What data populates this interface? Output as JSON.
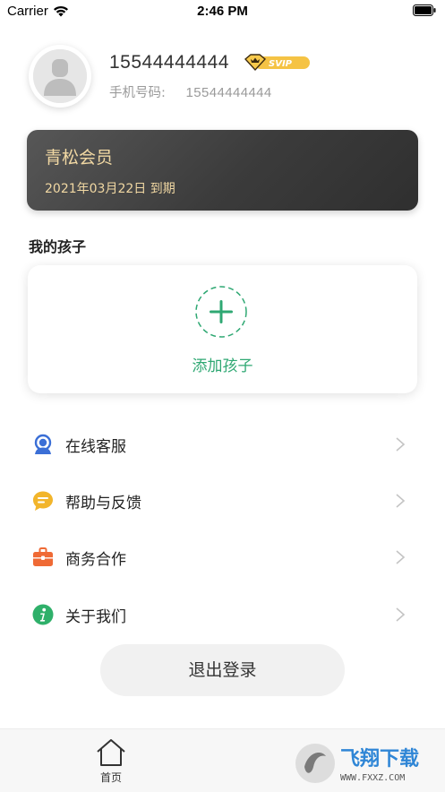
{
  "status_bar": {
    "carrier": "Carrier",
    "time": "2:46 PM"
  },
  "profile": {
    "username": "15544444444",
    "badge": "SVIP",
    "phone_label": "手机号码:",
    "phone_value": "15544444444"
  },
  "membership": {
    "title": "青松会员",
    "expire": "2021年03月22日 到期"
  },
  "kids": {
    "heading": "我的孩子",
    "add_label": "添加孩子"
  },
  "menu": [
    {
      "label": "在线客服",
      "icon": "customer-service-icon",
      "color": "#3b6fd6"
    },
    {
      "label": "帮助与反馈",
      "icon": "chat-bubble-icon",
      "color": "#f2b52b"
    },
    {
      "label": "商务合作",
      "icon": "briefcase-icon",
      "color": "#ef6a35"
    },
    {
      "label": "关于我们",
      "icon": "info-icon",
      "color": "#2fb06a"
    }
  ],
  "logout_label": "退出登录",
  "tabbar": {
    "home_label": "首页"
  },
  "watermark": {
    "text": "飞翔下载",
    "url": "WWW.FXXZ.COM"
  },
  "colors": {
    "accent": "#2fa873",
    "gold": "#f1d8a3",
    "card_dark": "#3b3b3b"
  }
}
